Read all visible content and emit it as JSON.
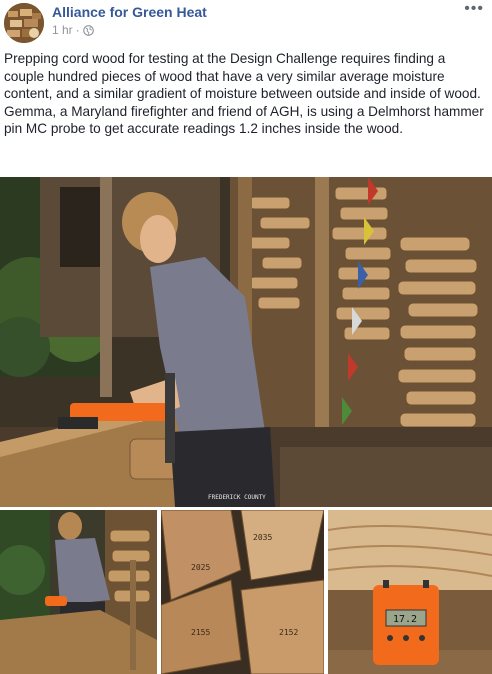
{
  "post": {
    "page_name": "Alliance for Green Heat",
    "timestamp": "1 hr",
    "separator": "·",
    "privacy_icon": "globe-icon",
    "more_icon": "more-options-icon",
    "more_label": "•••",
    "text": "Prepping cord wood for testing at the Design Challenge requires finding a couple hundred pieces of wood that have a very similar average moisture content, and a similar gradient of moisture between outside and inside of wood. Gemma, a Maryland firefighter and friend of AGH, is using a Delmhorst hammer pin MC probe to get accurate readings 1.2 inches inside the wood."
  },
  "photos": {
    "shirt_print": "FREDERICK COUNTY",
    "log_label_1": "2035",
    "log_label_2": "2025",
    "log_label_3": "2155",
    "log_label_4": "2152",
    "meter_reading": "17.2"
  },
  "colors": {
    "link": "#365899",
    "meta": "#90949c",
    "meter_orange": "#f26a1b"
  }
}
